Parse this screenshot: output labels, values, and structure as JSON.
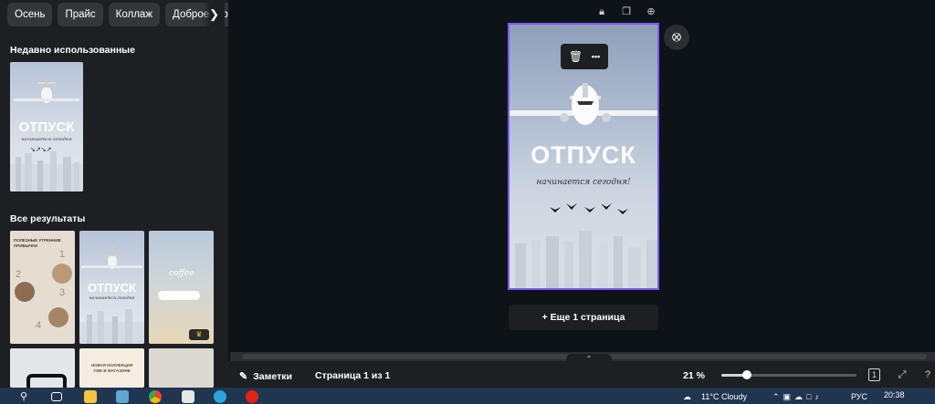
{
  "sidebar": {
    "chips": [
      "Осень",
      "Прайс",
      "Коллаж",
      "Доброе утро"
    ],
    "recent_title": "Недавно использованные",
    "results_title": "Все результаты",
    "recent_thumb": {
      "title": "ОТПУСК",
      "subtitle": "начинается сегодня"
    },
    "results": [
      {
        "kind": "habits",
        "lines": [
          "ПОЛЕЗНЫЕ УТРЕННИЕ",
          "ПРИВЫЧКИ"
        ],
        "nums": [
          "1",
          "2",
          "3",
          "4"
        ]
      },
      {
        "kind": "vacation",
        "title": "ОТПУСК",
        "subtitle": "начинается сегодня"
      },
      {
        "kind": "coffee",
        "script": "coffee"
      },
      {
        "kind": "phone"
      },
      {
        "kind": "collection",
        "lines": [
          "НОВАЯ КОЛЛЕКЦИЯ",
          "УЖЕ В МАГАЗИНЕ"
        ]
      },
      {
        "kind": "plain"
      }
    ]
  },
  "design": {
    "title": "ОТПУСК",
    "subtitle": "начинается сегодня!"
  },
  "toolbar": {
    "more_label": "•••"
  },
  "add_page_label": "+ Еще 1 страница",
  "bottom": {
    "notes_label": "Заметки",
    "page_counter": "Страница 1 из 1",
    "zoom_label": "21 %",
    "zoom_value": 21,
    "pages_badge": "1"
  },
  "taskbar": {
    "weather": "11°C  Cloudy",
    "lang": "РУС",
    "time": "20:38"
  },
  "colors": {
    "accent": "#7a5af5",
    "sidebar": "#1d1f23",
    "workspace": "#0e1318"
  }
}
